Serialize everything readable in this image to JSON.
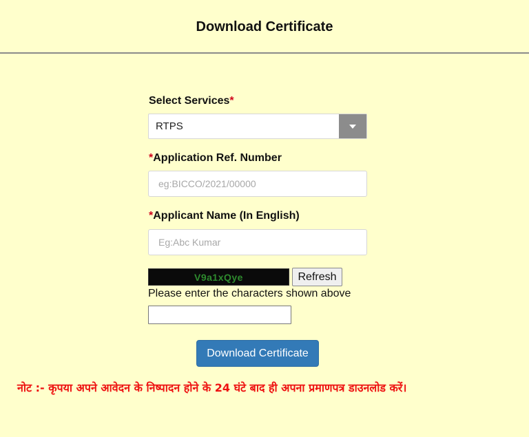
{
  "header": {
    "title": "Download Certificate"
  },
  "form": {
    "service": {
      "label": "Select Services",
      "required_mark": "*",
      "selected": "RTPS"
    },
    "ref_number": {
      "required_mark": "*",
      "label": "Application Ref. Number",
      "placeholder": "eg:BICCO/2021/00000",
      "value": ""
    },
    "applicant_name": {
      "required_mark": "*",
      "label": "Applicant Name (In English)",
      "placeholder": "Eg:Abc Kumar",
      "value": ""
    },
    "captcha": {
      "code": "V9a1xQye",
      "refresh_label": "Refresh",
      "hint": "Please enter the characters shown above",
      "value": ""
    },
    "submit_label": "Download Certificate"
  },
  "note": "नोट :- कृपया अपने आवेदन के निष्पादन होने के 24 घंटे बाद ही अपना प्रमाणपत्र डाउनलोड करें।",
  "colors": {
    "background": "#ffffcc",
    "primary_button": "#337ab7",
    "required": "#d0021b",
    "note": "#ee1111",
    "captcha_text": "#2e8b2e"
  },
  "icons": {
    "select_arrow": "chevron-down-icon"
  }
}
